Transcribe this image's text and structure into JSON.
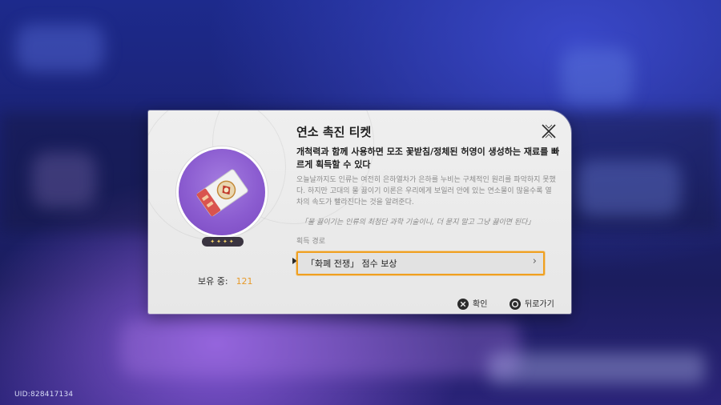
{
  "footer_uid": "UID:828417134",
  "item": {
    "title": "연소 촉진 티켓",
    "description_bold": "개척력과 함께 사용하면 모조 꽃받침/정체된 허영이 생성하는 재료를 빠르게 획득할 수 있다",
    "description": "오늘날까지도 인류는 여전히 은하열차가 은하를 누비는 구체적인 원리를 파악하지 못했다. 하지만 고대의 물 끓이기 이론은 우리에게 보일러 안에 있는 연소물이 많을수록 열차의 속도가 빨라진다는 것을 알려준다.",
    "quote": "「물 끓이기는 인류의 최첨단 과학 기술이니, 더 묻지 말고 그냥 끓이면 된다」",
    "rarity_stars": "✦✦✦✦",
    "owned_label": "보유 중:",
    "owned_count": "121",
    "icon": "ticket-icon",
    "accent_color": "#8b5cd0"
  },
  "acquisition": {
    "label": "획득 경로",
    "sources": [
      {
        "label": "「화폐 전쟁」 점수 보상",
        "chevron": "›"
      }
    ]
  },
  "footer": {
    "confirm_label": "확인",
    "confirm_icon": "cross-button-icon",
    "back_label": "뒤로가기",
    "back_icon": "circle-button-icon"
  },
  "colors": {
    "highlight": "#f0a020",
    "count": "#e79a2a"
  }
}
